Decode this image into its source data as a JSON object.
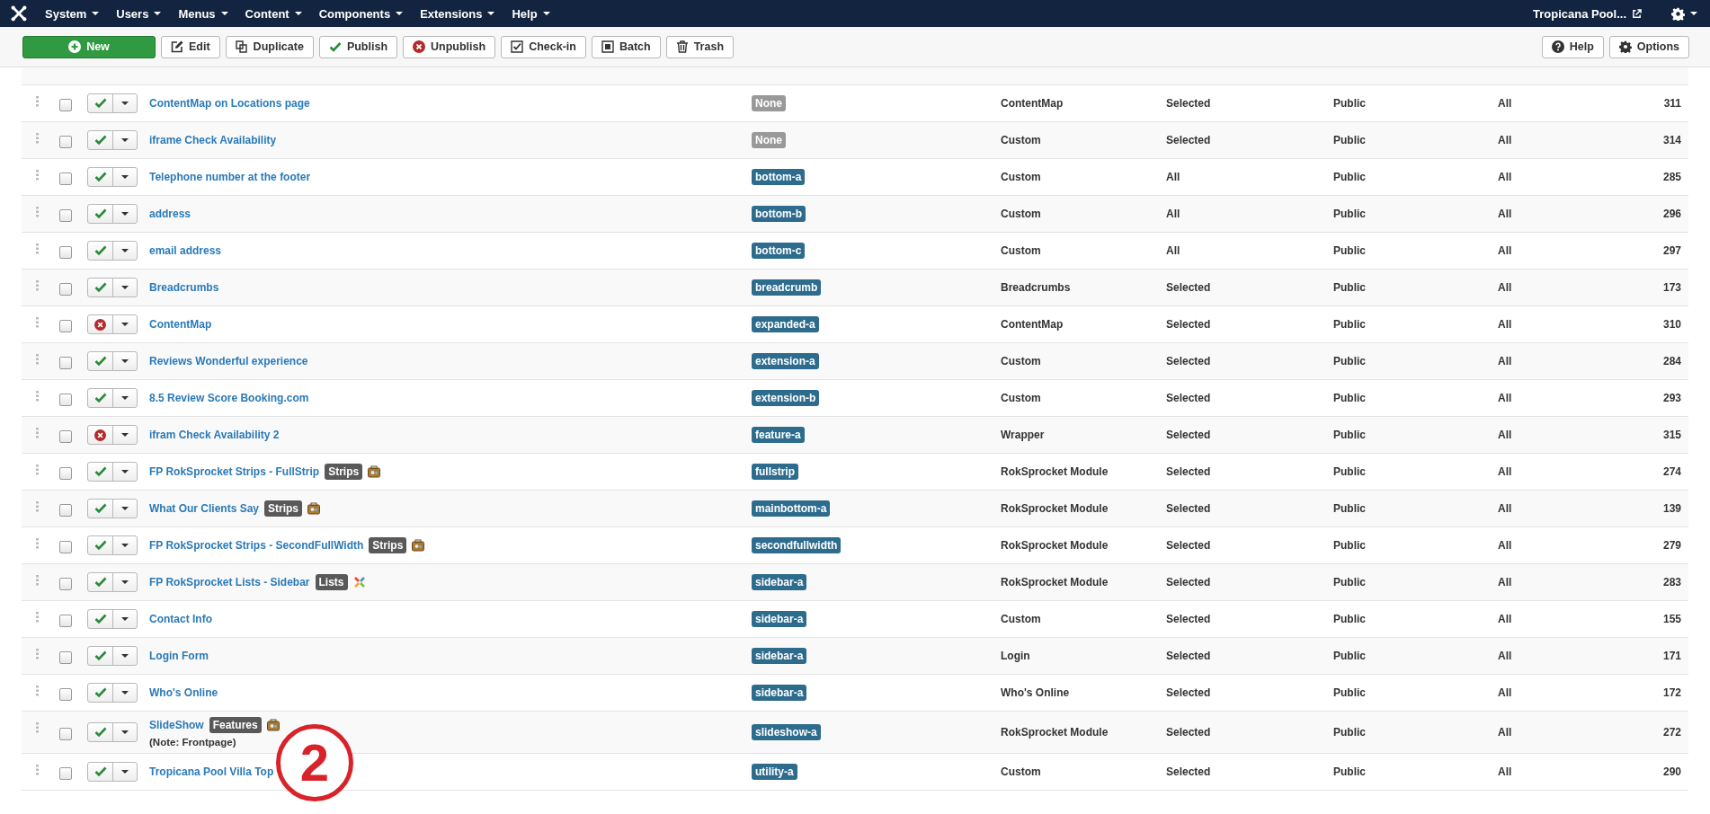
{
  "navbar": {
    "menus": [
      "System",
      "Users",
      "Menus",
      "Content",
      "Components",
      "Extensions",
      "Help"
    ],
    "site_link": "Tropicana Pool..."
  },
  "toolbar": {
    "buttons": [
      {
        "label": "New",
        "kind": "new"
      },
      {
        "label": "Edit",
        "kind": "edit"
      },
      {
        "label": "Duplicate",
        "kind": "duplicate"
      },
      {
        "label": "Publish",
        "kind": "publish"
      },
      {
        "label": "Unpublish",
        "kind": "unpublish"
      },
      {
        "label": "Check-in",
        "kind": "checkin"
      },
      {
        "label": "Batch",
        "kind": "batch"
      },
      {
        "label": "Trash",
        "kind": "trash"
      }
    ],
    "right_buttons": [
      {
        "label": "Help",
        "kind": "help"
      },
      {
        "label": "Options",
        "kind": "options"
      }
    ]
  },
  "modules": [
    {
      "title": "ContentMap on Locations page",
      "checked": false,
      "published": true,
      "position": "None",
      "assigned": false,
      "type": "ContentMap",
      "pages": "Selected",
      "access": "Public",
      "language": "All",
      "id": "311"
    },
    {
      "title": "iframe Check Availability",
      "checked": false,
      "published": true,
      "position": "None",
      "assigned": false,
      "type": "Custom",
      "pages": "Selected",
      "access": "Public",
      "language": "All",
      "id": "314"
    },
    {
      "title": "Telephone number at the footer",
      "checked": false,
      "published": true,
      "position": "bottom-a",
      "assigned": true,
      "type": "Custom",
      "pages": "All",
      "access": "Public",
      "language": "All",
      "id": "285"
    },
    {
      "title": "address",
      "checked": false,
      "published": true,
      "position": "bottom-b",
      "assigned": true,
      "type": "Custom",
      "pages": "All",
      "access": "Public",
      "language": "All",
      "id": "296"
    },
    {
      "title": "email address",
      "checked": false,
      "published": true,
      "position": "bottom-c",
      "assigned": true,
      "type": "Custom",
      "pages": "All",
      "access": "Public",
      "language": "All",
      "id": "297"
    },
    {
      "title": "Breadcrumbs",
      "checked": false,
      "published": true,
      "position": "breadcrumb",
      "assigned": true,
      "type": "Breadcrumbs",
      "pages": "Selected",
      "access": "Public",
      "language": "All",
      "id": "173"
    },
    {
      "title": "ContentMap",
      "checked": false,
      "published": false,
      "position": "expanded-a",
      "assigned": true,
      "type": "ContentMap",
      "pages": "Selected",
      "access": "Public",
      "language": "All",
      "id": "310"
    },
    {
      "title": "Reviews Wonderful experience",
      "checked": false,
      "published": true,
      "position": "extension-a",
      "assigned": true,
      "type": "Custom",
      "pages": "Selected",
      "access": "Public",
      "language": "All",
      "id": "284"
    },
    {
      "title": "8.5 Review Score Booking.com",
      "checked": false,
      "published": true,
      "position": "extension-b",
      "assigned": true,
      "type": "Custom",
      "pages": "Selected",
      "access": "Public",
      "language": "All",
      "id": "293"
    },
    {
      "title": "ifram Check Availability 2",
      "checked": false,
      "published": false,
      "position": "feature-a",
      "assigned": true,
      "type": "Wrapper",
      "pages": "Selected",
      "access": "Public",
      "language": "All",
      "id": "315"
    },
    {
      "title": "FP RokSprocket Strips - FullStrip",
      "badge": "Strips",
      "icon": {
        "kind": "sprocket"
      },
      "checked": false,
      "published": true,
      "position": "fullstrip",
      "assigned": true,
      "type": "RokSprocket Module",
      "pages": "Selected",
      "access": "Public",
      "language": "All",
      "id": "274"
    },
    {
      "title": "What Our Clients Say",
      "badge": "Strips",
      "icon": {
        "kind": "sprocket"
      },
      "checked": false,
      "published": true,
      "position": "mainbottom-a",
      "assigned": true,
      "type": "RokSprocket Module",
      "pages": "Selected",
      "access": "Public",
      "language": "All",
      "id": "139"
    },
    {
      "title": "FP RokSprocket Strips - SecondFullWidth",
      "badge": "Strips",
      "icon": {
        "kind": "sprocket"
      },
      "checked": false,
      "published": true,
      "position": "secondfullwidth",
      "assigned": true,
      "type": "RokSprocket Module",
      "pages": "Selected",
      "access": "Public",
      "language": "All",
      "id": "279"
    },
    {
      "title": "FP RokSprocket Lists - Sidebar",
      "badge": "Lists",
      "icon": {
        "kind": "joomla"
      },
      "checked": false,
      "published": true,
      "position": "sidebar-a",
      "assigned": true,
      "type": "RokSprocket Module",
      "pages": "Selected",
      "access": "Public",
      "language": "All",
      "id": "283"
    },
    {
      "title": "Contact Info",
      "checked": false,
      "published": true,
      "position": "sidebar-a",
      "assigned": true,
      "type": "Custom",
      "pages": "Selected",
      "access": "Public",
      "language": "All",
      "id": "155"
    },
    {
      "title": "Login Form",
      "checked": false,
      "published": true,
      "position": "sidebar-a",
      "assigned": true,
      "type": "Login",
      "pages": "Selected",
      "access": "Public",
      "language": "All",
      "id": "171"
    },
    {
      "title": "Who's Online",
      "checked": false,
      "published": true,
      "position": "sidebar-a",
      "assigned": true,
      "type": "Who's Online",
      "pages": "Selected",
      "access": "Public",
      "language": "All",
      "id": "172"
    },
    {
      "title": "SlideShow",
      "badge": "Features",
      "icon": {
        "kind": "sprocket"
      },
      "note": "(Note: Frontpage)",
      "checked": false,
      "published": true,
      "position": "slideshow-a",
      "assigned": true,
      "type": "RokSprocket Module",
      "pages": "Selected",
      "access": "Public",
      "language": "All",
      "id": "272"
    },
    {
      "title": "Tropicana Pool Villa Top",
      "checked": false,
      "published": true,
      "position": "utility-a",
      "assigned": true,
      "type": "Custom",
      "pages": "Selected",
      "access": "Public",
      "language": "All",
      "id": "290"
    }
  ],
  "annotation": {
    "number": "2"
  }
}
